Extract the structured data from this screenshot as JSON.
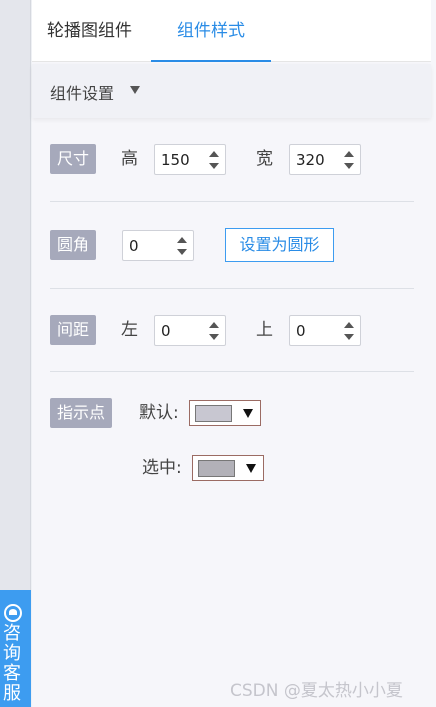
{
  "tabs": [
    {
      "label": "轮播图组件"
    },
    {
      "label": "组件样式"
    }
  ],
  "active_tab_color": "#2a8ce6",
  "section": {
    "title": "组件设置"
  },
  "size": {
    "badge": "尺寸",
    "height_label": "高",
    "height_value": "150",
    "width_label": "宽",
    "width_value": "320"
  },
  "radius": {
    "badge": "圆角",
    "value": "0",
    "button": "设置为圆形"
  },
  "spacing": {
    "badge": "间距",
    "left_label": "左",
    "left_value": "0",
    "top_label": "上",
    "top_value": "0"
  },
  "dots": {
    "badge": "指示点",
    "default_label": "默认:",
    "default_color": "#c8c7d1",
    "selected_label": "选中:",
    "selected_color": "#b2b1b8"
  },
  "support": {
    "label": "咨询客服"
  },
  "watermark": "CSDN @夏太热小小夏"
}
